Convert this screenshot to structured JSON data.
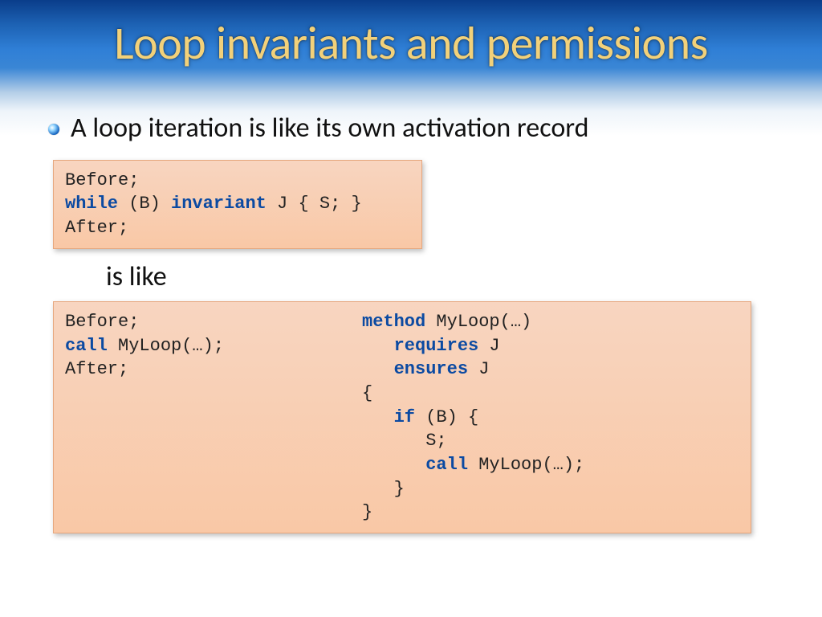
{
  "title": "Loop invariants and permissions",
  "bullet": "A loop iteration is like its own activation record",
  "islike": "is like",
  "code1": {
    "l1": "Before;",
    "l2a": "while",
    "l2b": " (B) ",
    "l2c": "invariant",
    "l2d": " J { S; }",
    "l3": "After;"
  },
  "code2L": {
    "l1": "Before;",
    "l2a": "call",
    "l2b": " MyLoop(…);",
    "l3": "After;"
  },
  "code2R": {
    "l1a": "method",
    "l1b": " MyLoop(…)",
    "l2a": "   ",
    "l2b": "requires",
    "l2c": " J",
    "l3a": "   ",
    "l3b": "ensures",
    "l3c": " J",
    "l4": "{",
    "l5a": "   ",
    "l5b": "if",
    "l5c": " (B) {",
    "l6": "      S;",
    "l7a": "      ",
    "l7b": "call",
    "l7c": " MyLoop(…);",
    "l8": "   }",
    "l9": "}"
  }
}
